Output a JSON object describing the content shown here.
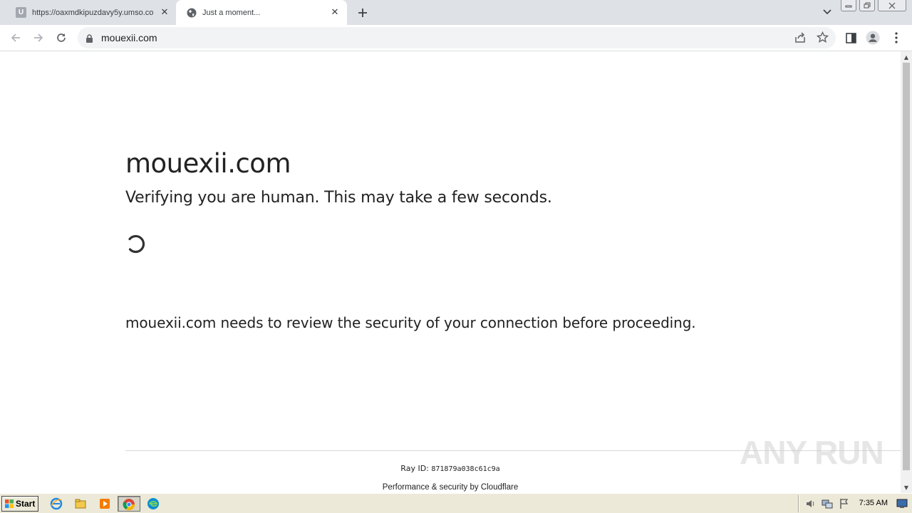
{
  "browser": {
    "tabs": [
      {
        "title": "https://oaxmdkipuzdavy5y.umso.co",
        "favicon_letter": "U",
        "active": false
      },
      {
        "title": "Just a moment...",
        "active": true
      }
    ],
    "address": "mouexii.com"
  },
  "page": {
    "domain_heading": "mouexii.com",
    "subheading": "Verifying you are human. This may take a few seconds.",
    "review_text": "mouexii.com needs to review the security of your connection before proceeding.",
    "ray_label": "Ray ID: ",
    "ray_id": "871879a038c61c9a",
    "footer_text": "Performance & security by Cloudflare"
  },
  "watermark": "ANY RUN",
  "taskbar": {
    "start_label": "Start",
    "clock": "7:35 AM"
  },
  "colors": {
    "tabstrip": "#dee1e6",
    "taskbar": "#ece9d8",
    "text": "#222222"
  }
}
